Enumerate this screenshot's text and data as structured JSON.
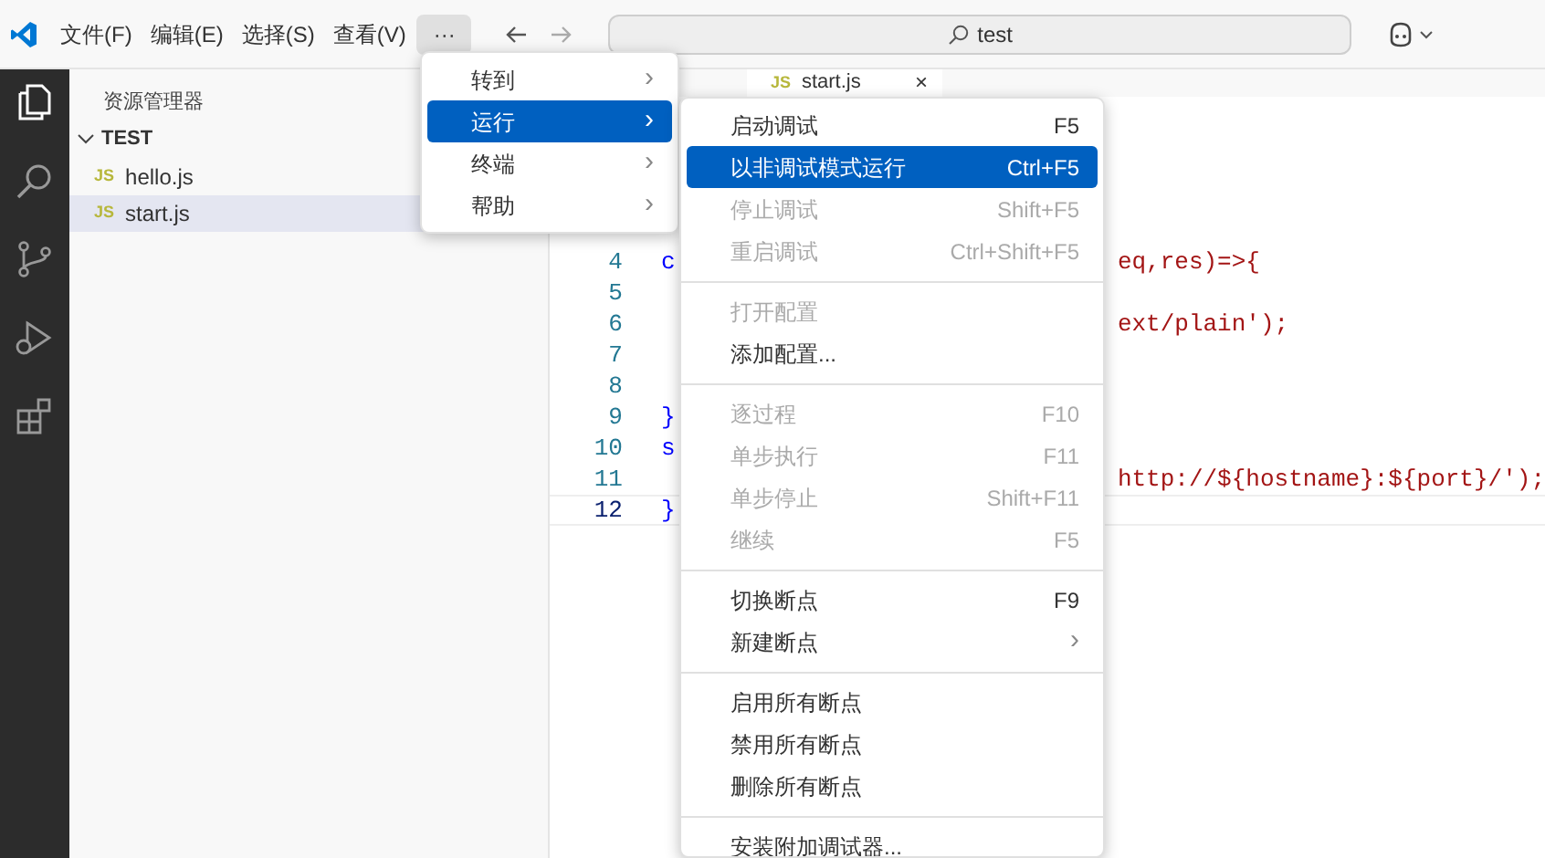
{
  "menu_bar": {
    "items": [
      {
        "label": "文件(F)",
        "selected": false
      },
      {
        "label": "编辑(E)",
        "selected": false
      },
      {
        "label": "选择(S)",
        "selected": false
      },
      {
        "label": "查看(V)",
        "selected": false
      },
      {
        "label": "···",
        "selected": true
      }
    ]
  },
  "search": {
    "value": "test"
  },
  "sidebar": {
    "title": "资源管理器",
    "folder": {
      "label": "TEST",
      "expanded": true,
      "children": [
        {
          "label": "hello.js",
          "badge": "JS",
          "selected": false
        },
        {
          "label": "start.js",
          "badge": "JS",
          "selected": true
        }
      ]
    }
  },
  "tabs": [
    {
      "label": "start.js",
      "badge": "JS",
      "close": "×",
      "selected": true
    }
  ],
  "editor": {
    "lines": [
      {
        "number": "4",
        "left": "c",
        "right": "eq,res)=>{",
        "current": false
      },
      {
        "number": "5",
        "current": false
      },
      {
        "number": "6",
        "right": "ext/plain');",
        "current": false
      },
      {
        "number": "7",
        "current": false
      },
      {
        "number": "8",
        "current": false
      },
      {
        "number": "9",
        "left": "}",
        "current": false
      },
      {
        "number": "10",
        "left": "s",
        "current": false
      },
      {
        "number": "11",
        "right": "http://${hostname}:${port}/');",
        "current": false
      },
      {
        "number": "12",
        "left": "}",
        "current": true
      }
    ]
  },
  "menu": {
    "items": [
      {
        "label": "转到",
        "selected": false
      },
      {
        "label": "运行",
        "selected": true
      },
      {
        "label": "终端",
        "selected": false
      },
      {
        "label": "帮助",
        "selected": false
      }
    ],
    "submenu_mark": "›"
  },
  "submenu": {
    "items": [
      {
        "kind": "item",
        "label": "启动调试",
        "shortcut": "F5",
        "disabled": false,
        "selected": false
      },
      {
        "kind": "item",
        "label": "以非调试模式运行",
        "shortcut": "Ctrl+F5",
        "disabled": false,
        "selected": true
      },
      {
        "kind": "item",
        "label": "停止调试",
        "shortcut": "Shift+F5",
        "disabled": true,
        "selected": false
      },
      {
        "kind": "item",
        "label": "重启调试",
        "shortcut": "Ctrl+Shift+F5",
        "disabled": true,
        "selected": false
      },
      {
        "kind": "separator"
      },
      {
        "kind": "item",
        "label": "打开配置",
        "disabled": true,
        "selected": false
      },
      {
        "kind": "item",
        "label": "添加配置...",
        "disabled": false,
        "selected": false
      },
      {
        "kind": "separator"
      },
      {
        "kind": "item",
        "label": "逐过程",
        "shortcut": "F10",
        "disabled": true,
        "selected": false
      },
      {
        "kind": "item",
        "label": "单步执行",
        "shortcut": "F11",
        "disabled": true,
        "selected": false
      },
      {
        "kind": "item",
        "label": "单步停止",
        "shortcut": "Shift+F11",
        "disabled": true,
        "selected": false
      },
      {
        "kind": "item",
        "label": "继续",
        "shortcut": "F5",
        "disabled": true,
        "selected": false
      },
      {
        "kind": "separator"
      },
      {
        "kind": "item",
        "label": "切换断点",
        "shortcut": "F9",
        "disabled": false,
        "selected": false
      },
      {
        "kind": "item",
        "label": "新建断点",
        "submenu": "›",
        "disabled": false,
        "selected": false
      },
      {
        "kind": "separator"
      },
      {
        "kind": "item",
        "label": "启用所有断点",
        "disabled": false,
        "selected": false
      },
      {
        "kind": "item",
        "label": "禁用所有断点",
        "disabled": false,
        "selected": false
      },
      {
        "kind": "item",
        "label": "删除所有断点",
        "disabled": false,
        "selected": false
      },
      {
        "kind": "separator"
      },
      {
        "kind": "item",
        "label": "安装附加调试器...",
        "disabled": false,
        "selected": false
      }
    ]
  }
}
